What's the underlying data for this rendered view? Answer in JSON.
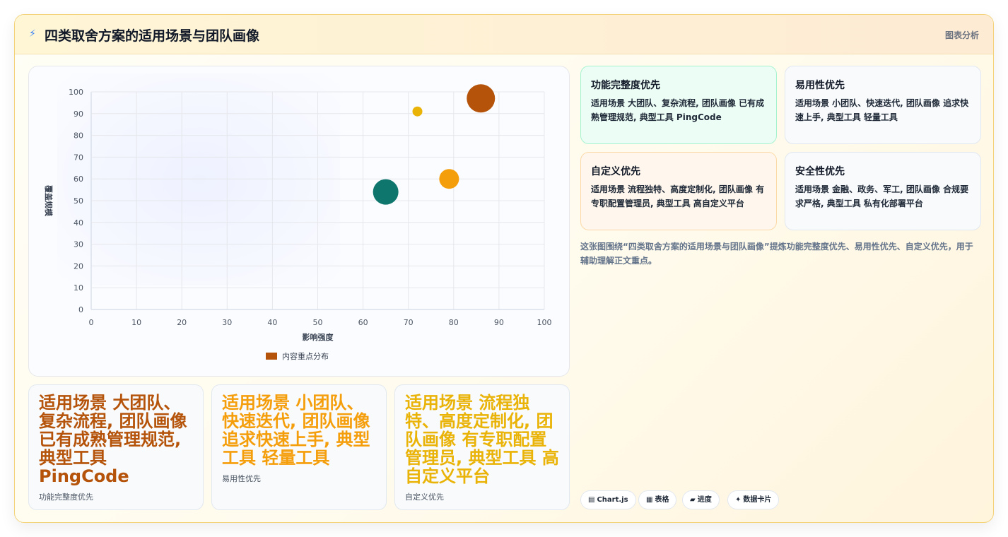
{
  "header": {
    "icon": "bolt-icon",
    "title": "四类取舍方案的适用场景与团队画像",
    "right_label": "图表分析"
  },
  "chart_data": {
    "type": "scatter",
    "title": "",
    "xlabel": "影响强度",
    "ylabel": "覆盖规模",
    "xlim": [
      0,
      100
    ],
    "ylim": [
      0,
      100
    ],
    "xticks": [
      0,
      10,
      20,
      30,
      40,
      50,
      60,
      70,
      80,
      90,
      100
    ],
    "yticks": [
      0,
      10,
      20,
      30,
      40,
      50,
      60,
      70,
      80,
      90,
      100
    ],
    "grid": true,
    "legend_position": "bottom",
    "series": [
      {
        "name": "内容重点分布",
        "color": "#b45309",
        "points": [
          {
            "x": 86,
            "y": 97,
            "r": 20,
            "color": "#b45309"
          },
          {
            "x": 72,
            "y": 91,
            "r": 7,
            "color": "#eab308"
          },
          {
            "x": 79,
            "y": 60,
            "r": 14,
            "color": "#f59e0b"
          },
          {
            "x": 65,
            "y": 54,
            "r": 18,
            "color": "#0f766e"
          }
        ]
      }
    ]
  },
  "quadrants": [
    {
      "title": "功能完整度优先",
      "desc": "适用场景 大团队、复杂流程, 团队画像 已有成熟管理规范, 典型工具 PingCode",
      "bg": "#ecfdf5",
      "border": "#a7f3d0"
    },
    {
      "title": "易用性优先",
      "desc": "适用场景 小团队、快速迭代, 团队画像 追求快速上手, 典型工具 轻量工具",
      "bg": "#f8fafc",
      "border": "#e2e8f0"
    },
    {
      "title": "自定义优先",
      "desc": "适用场景 流程独特、高度定制化, 团队画像 有专职配置管理员, 典型工具 高自定义平台",
      "bg": "#fff7ed",
      "border": "#fcd9a8"
    },
    {
      "title": "安全性优先",
      "desc": "适用场景 金融、政务、军工, 团队画像 合规要求严格, 典型工具 私有化部署平台",
      "bg": "#f8fafc",
      "border": "#e2e8f0"
    }
  ],
  "note": "这张图围绕“四类取舍方案的适用场景与团队画像”提炼功能完整度优先、易用性优先、自定义优先，用于辅助理解正文重点。",
  "bottom_cards": [
    {
      "big": "适用场景 大团队、复杂流程, 团队画像 已有成熟管理规范, 典型工具 PingCode",
      "sub": "功能完整度优先",
      "color": "#b45309"
    },
    {
      "big": "适用场景 小团队、快速迭代, 团队画像 追求快速上手, 典型工具 轻量工具",
      "sub": "易用性优先",
      "color": "#f59e0b"
    },
    {
      "big": "适用场景 流程独特、高度定制化, 团队画像 有专职配置管理员, 典型工具 高自定义平台",
      "sub": "自定义优先",
      "color": "#eab308"
    }
  ],
  "chips": [
    {
      "icon": "chart-icon",
      "glyph": "▤",
      "label": "Chart.js"
    },
    {
      "icon": "table-icon",
      "glyph": "▦",
      "label": "表格"
    },
    {
      "icon": "progress-icon",
      "glyph": "▰",
      "label": "进度"
    },
    {
      "icon": "sparkle-icon",
      "glyph": "✦",
      "label": "数据卡片"
    }
  ]
}
